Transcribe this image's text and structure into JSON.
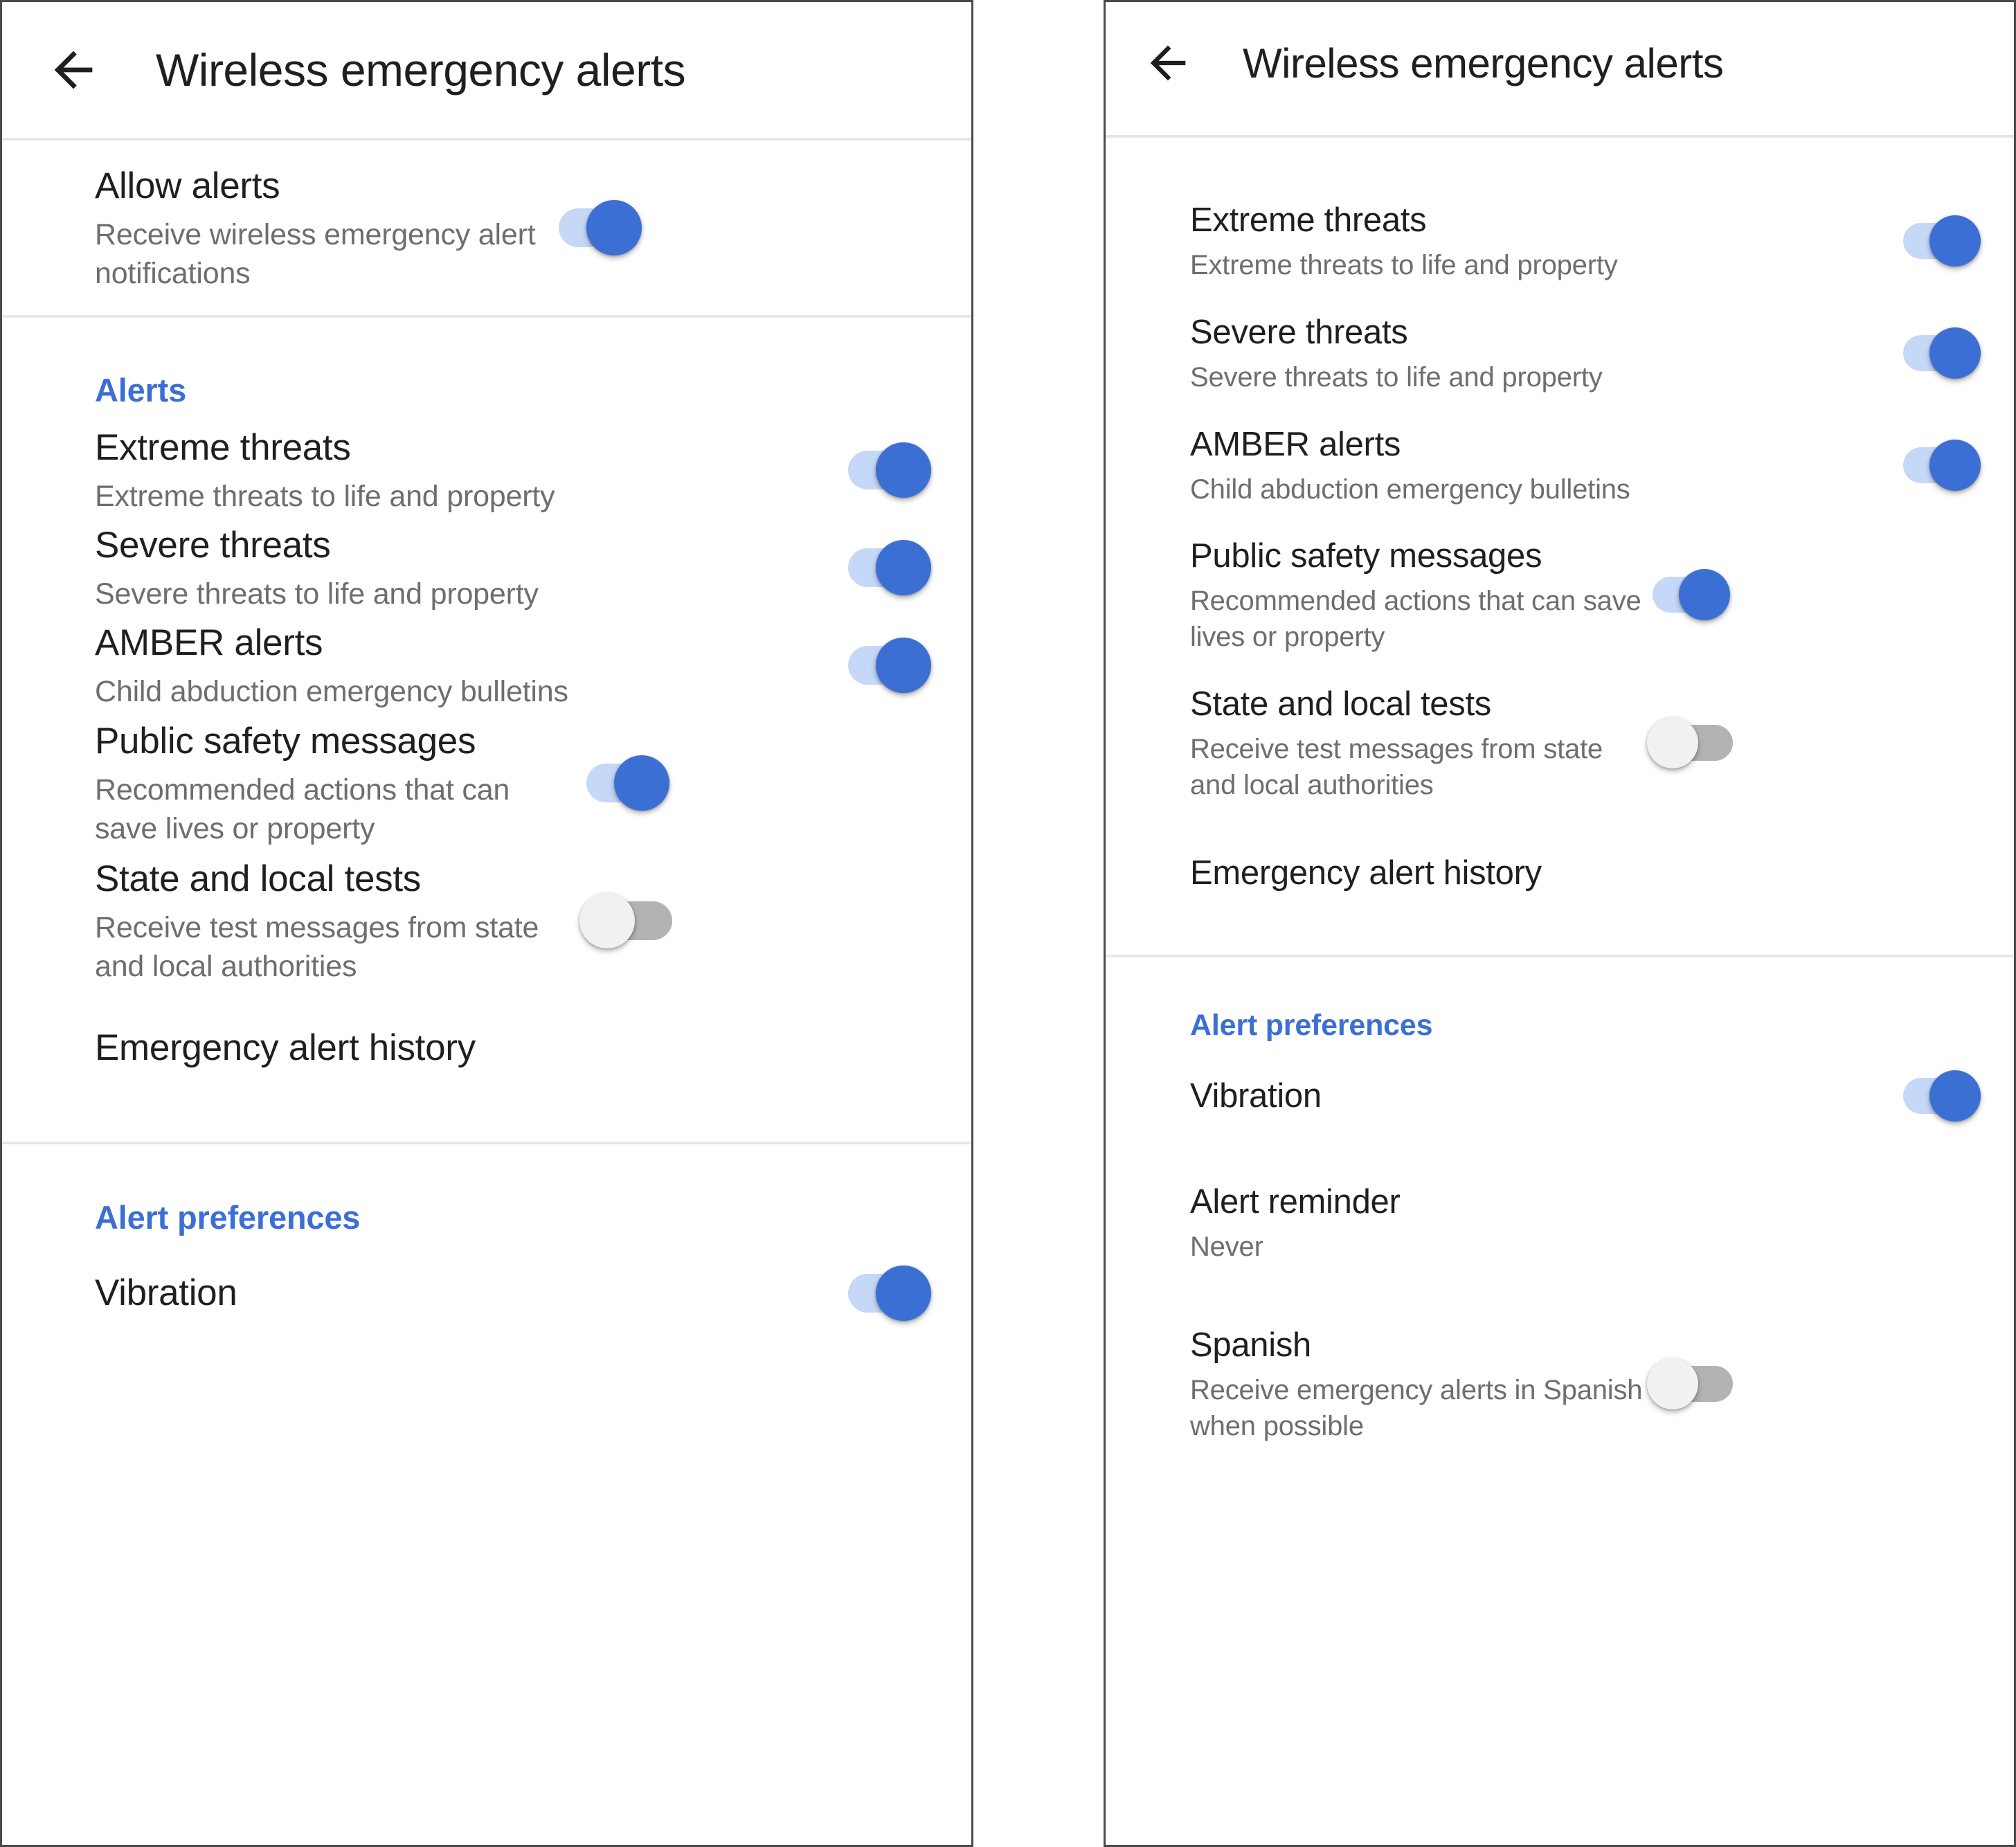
{
  "screen": {
    "title": "Wireless emergency alerts",
    "back_icon": "arrow-left-icon",
    "accent_color": "#3b6fd4",
    "toggle_on_track_color": "#c6d8f7",
    "toggle_on_thumb_color": "#3b6fd4",
    "toggle_off_track_color": "#b3b3b3",
    "toggle_off_thumb_color": "#f1f1f1",
    "title_color": "#1f1f1f",
    "subtitle_color": "#6e6e6e"
  },
  "left_panel": {
    "appbar": {
      "title": "Wireless emergency alerts",
      "back_label": "Back"
    },
    "top_group": [
      {
        "title": "Allow alerts",
        "subtitle": "Receive wireless emergency alert notifications",
        "toggle": "on"
      }
    ],
    "alerts_section": {
      "header": "Alerts",
      "items": [
        {
          "title": "Extreme threats",
          "subtitle": "Extreme threats to life and property",
          "toggle": "on"
        },
        {
          "title": "Severe threats",
          "subtitle": "Severe threats to life and property",
          "toggle": "on"
        },
        {
          "title": "AMBER alerts",
          "subtitle": "Child abduction emergency bulletins",
          "toggle": "on"
        },
        {
          "title": "Public safety messages",
          "subtitle": "Recommended actions that can save lives or property",
          "toggle": "on"
        },
        {
          "title": "State and local tests",
          "subtitle": "Receive test messages from state and local authorities",
          "toggle": "off"
        },
        {
          "title": "Emergency alert history",
          "subtitle": "",
          "toggle": "none"
        }
      ]
    },
    "preferences_section": {
      "header": "Alert preferences",
      "items": [
        {
          "title": "Vibration",
          "subtitle": "",
          "toggle": "on"
        }
      ]
    }
  },
  "right_panel": {
    "appbar": {
      "title": "Wireless emergency alerts",
      "back_label": "Back"
    },
    "clipped_row_text": "Allow alerts",
    "alerts_section": {
      "items": [
        {
          "title": "Extreme threats",
          "subtitle": "Extreme threats to life and property",
          "toggle": "on"
        },
        {
          "title": "Severe threats",
          "subtitle": "Severe threats to life and property",
          "toggle": "on"
        },
        {
          "title": "AMBER alerts",
          "subtitle": "Child abduction emergency bulletins",
          "toggle": "on"
        },
        {
          "title": "Public safety messages",
          "subtitle": "Recommended actions that can save lives or property",
          "toggle": "on"
        },
        {
          "title": "State and local tests",
          "subtitle": "Receive test messages from state and local authorities",
          "toggle": "off"
        },
        {
          "title": "Emergency alert history",
          "subtitle": "",
          "toggle": "none"
        }
      ]
    },
    "preferences_section": {
      "header": "Alert preferences",
      "items": [
        {
          "title": "Vibration",
          "subtitle": "",
          "toggle": "on"
        },
        {
          "title": "Alert reminder",
          "subtitle": "Never",
          "toggle": "none"
        },
        {
          "title": "Spanish",
          "subtitle": "Receive emergency alerts in Spanish when possible",
          "toggle": "off"
        }
      ]
    }
  }
}
